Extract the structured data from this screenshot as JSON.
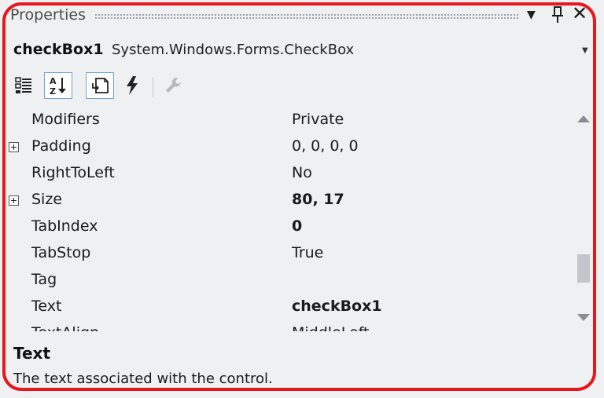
{
  "window": {
    "title": "Properties"
  },
  "object_selector": {
    "name": "checkBox1",
    "type": "System.Windows.Forms.CheckBox"
  },
  "toolbar": {
    "buttons": [
      {
        "icon": "categorized-icon",
        "active": false
      },
      {
        "icon": "alphabetical-icon",
        "active": true
      },
      {
        "icon": "properties-icon",
        "active": true
      },
      {
        "icon": "events-icon",
        "active": false
      },
      {
        "icon": "property-pages-icon",
        "active": false,
        "disabled": true
      }
    ]
  },
  "properties": [
    {
      "name": "Modifiers",
      "value": "Private",
      "bold": false,
      "expandable": false
    },
    {
      "name": "Padding",
      "value": "0, 0, 0, 0",
      "bold": false,
      "expandable": true
    },
    {
      "name": "RightToLeft",
      "value": "No",
      "bold": false,
      "expandable": false
    },
    {
      "name": "Size",
      "value": "80, 17",
      "bold": true,
      "expandable": true
    },
    {
      "name": "TabIndex",
      "value": "0",
      "bold": true,
      "expandable": false
    },
    {
      "name": "TabStop",
      "value": "True",
      "bold": false,
      "expandable": false
    },
    {
      "name": "Tag",
      "value": "",
      "bold": false,
      "expandable": false
    },
    {
      "name": "Text",
      "value": "checkBox1",
      "bold": true,
      "expandable": false
    },
    {
      "name": "TextAlign",
      "value": "MiddleLeft",
      "bold": false,
      "expandable": false
    }
  ],
  "description": {
    "title": "Text",
    "text": "The text associated with the control."
  },
  "colors": {
    "panel_bg": "#eef0f2",
    "highlight_border": "#e8161d",
    "active_tool_border": "#6aa3d9"
  }
}
